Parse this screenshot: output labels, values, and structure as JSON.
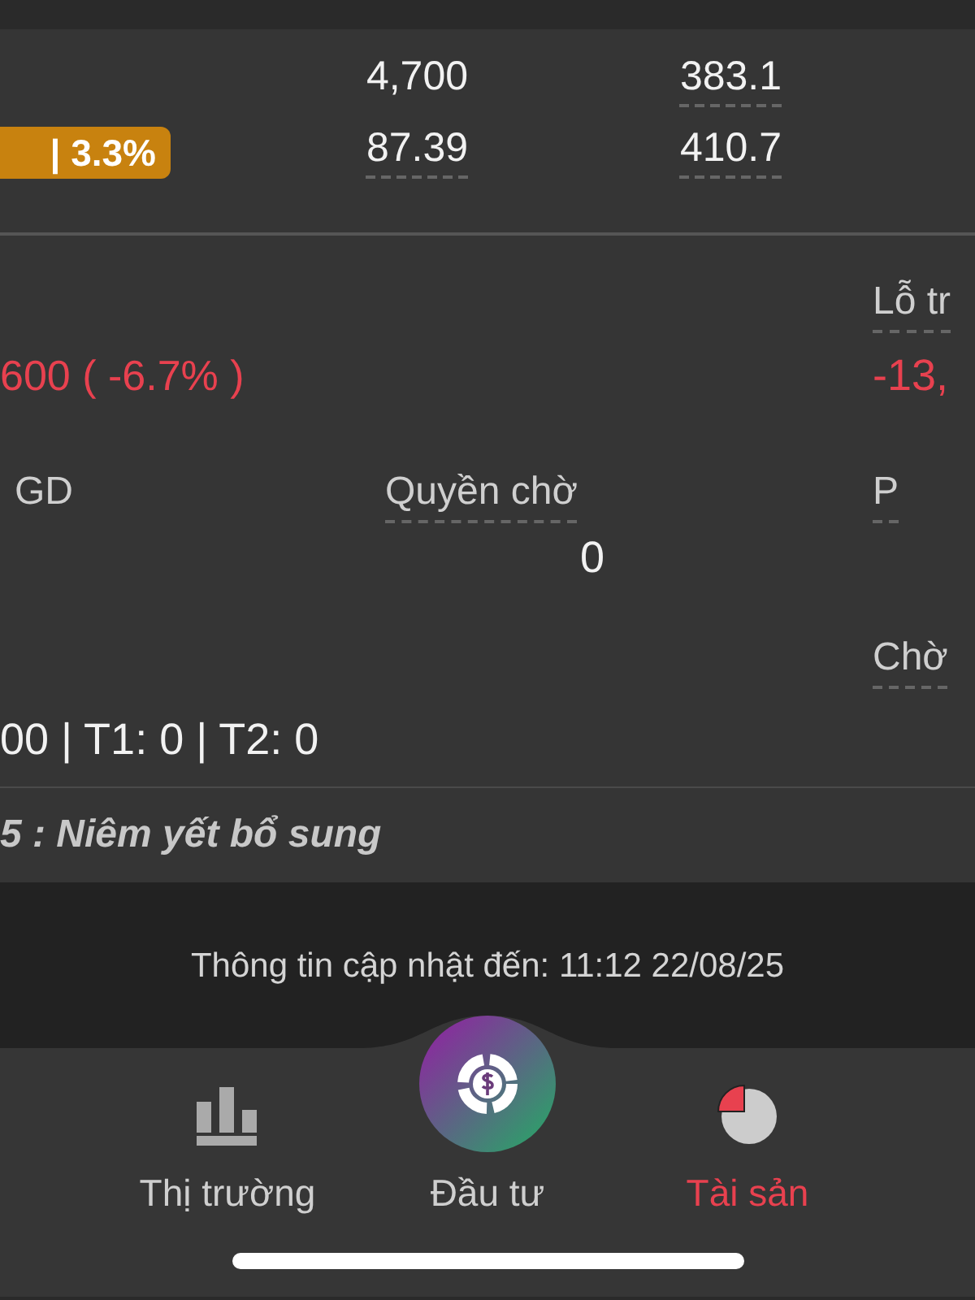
{
  "summary": {
    "badge": "| 3.3%",
    "rows": [
      {
        "cells": [
          {
            "text": "4,700",
            "kind": "plain"
          },
          {
            "text": "383.1",
            "kind": "hint"
          }
        ]
      },
      {
        "cells": [
          {
            "text": "87.39",
            "kind": "hint"
          },
          {
            "text": "410.7",
            "kind": "hint"
          }
        ]
      }
    ]
  },
  "details": {
    "loss": "600 ( -6.7% )",
    "trade_label": "GD",
    "rights_label": "Quyền chờ",
    "rights_value": "0",
    "settlement": "00 | T1: 0 | T2: 0",
    "side": {
      "loss_label": "Lỗ tr",
      "loss_value": "-13,",
      "p_label": "P",
      "pending_label": "Chờ"
    }
  },
  "note": "5 : Niêm yết bổ sung",
  "update_info": "Thông tin cập nhật đến: 11:12 22/08/25",
  "nav": [
    {
      "label": "Thị trường",
      "kind": "market",
      "selected": false
    },
    {
      "label": "Đầu tư",
      "kind": "invest",
      "selected": false
    },
    {
      "label": "Tài sản",
      "kind": "assets",
      "selected": true
    }
  ]
}
